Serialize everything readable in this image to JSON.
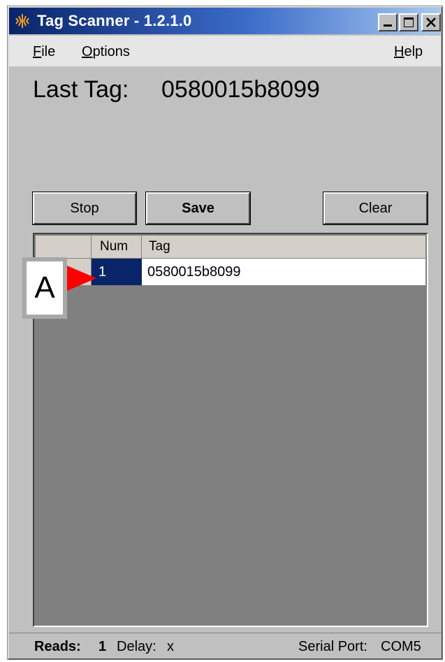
{
  "window": {
    "title": "Tag Scanner - 1.2.1.0",
    "icon": "tag-scanner-app-icon"
  },
  "menu": {
    "file": {
      "mnemonic": "F",
      "rest": "ile"
    },
    "options": {
      "mnemonic": "O",
      "rest": "ptions"
    },
    "help": {
      "mnemonic": "H",
      "rest": "elp"
    }
  },
  "last_tag": {
    "label": "Last Tag:",
    "value": "0580015b8099"
  },
  "buttons": {
    "stop": "Stop",
    "save": "Save",
    "clear": "Clear"
  },
  "grid": {
    "columns": [
      "Num",
      "Tag"
    ],
    "rows": [
      {
        "num": "1",
        "tag": "0580015b8099"
      }
    ]
  },
  "annotation": {
    "label": "A",
    "arrow_color": "#ff0000"
  },
  "status": {
    "reads_label": "Reads:",
    "reads_value": "1",
    "delay_label": "Delay:",
    "delay_value": "x",
    "port_label": "Serial Port:",
    "port_value": "COM5"
  },
  "colors": {
    "titlebar_start": "#0a246a",
    "titlebar_end": "#a6caf0",
    "selected_cell": "#0a246a",
    "grid_background": "#808080",
    "face": "#c0c0c0"
  }
}
